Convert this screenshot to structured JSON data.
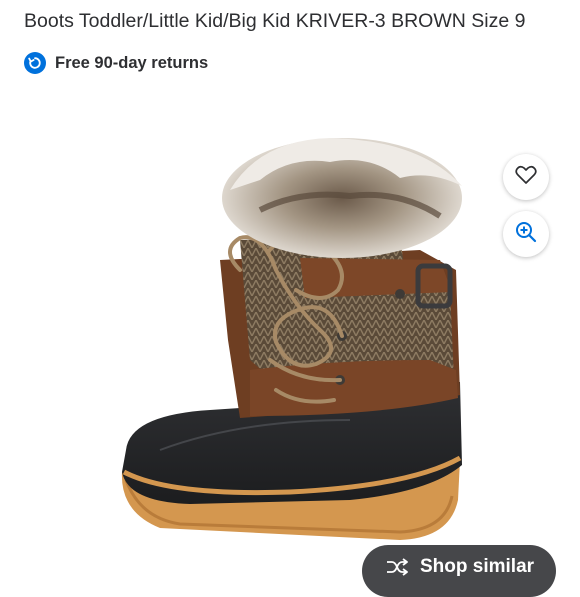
{
  "product": {
    "title": "Boots Toddler/Little Kid/Big Kid KRIVER-3 BROWN Size 9",
    "returns_label": "Free 90-day returns"
  },
  "actions": {
    "favorite_icon": "heart-icon",
    "zoom_icon": "zoom-in-icon",
    "shop_similar_label": "Shop similar",
    "shop_similar_icon": "shuffle-icon"
  },
  "colors": {
    "returns_badge": "#0071dc",
    "zoom_icon": "#0071dc",
    "shop_similar_bg": "#46474a"
  }
}
